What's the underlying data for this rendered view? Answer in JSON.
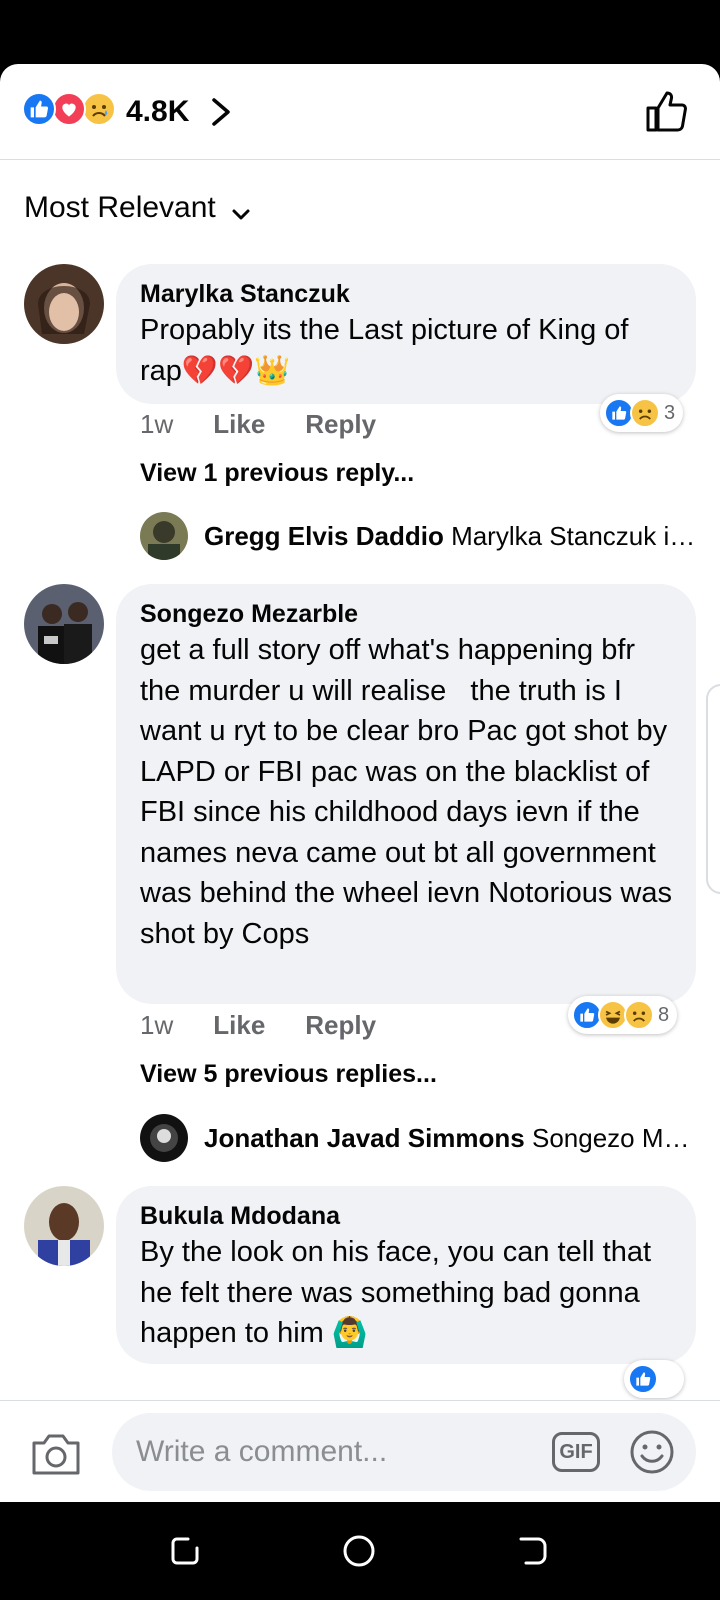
{
  "header": {
    "reaction_icons": [
      "like-icon",
      "love-icon",
      "sad-icon"
    ],
    "reaction_count": "4.8K"
  },
  "sort": {
    "label": "Most Relevant"
  },
  "comments": [
    {
      "author": "Marylka Stanczuk",
      "text": "Propably its the Last picture of King of rap💔💔👑",
      "time": "1w",
      "like_label": "Like",
      "reply_label": "Reply",
      "reactions": [
        "like",
        "sad"
      ],
      "reaction_count": "3",
      "view_previous": "View 1 previous reply...",
      "reply_preview": {
        "author": "Gregg Elvis Daddio",
        "text": "Marylka Stanczuk i…"
      }
    },
    {
      "author": "Songezo Mezarble",
      "text": "get a full story off what's happening bfr the murder u will realise   the truth is I want u ryt to be clear bro Pac got shot by LAPD or FBI pac was on the blacklist of FBI since his childhood days ievn if the names neva came out bt all government was behind the wheel ievn Notorious was shot by Cops",
      "time": "1w",
      "like_label": "Like",
      "reply_label": "Reply",
      "reactions": [
        "like",
        "haha",
        "sad"
      ],
      "reaction_count": "8",
      "view_previous": "View 5 previous replies...",
      "reply_preview": {
        "author": "Jonathan Javad Simmons",
        "text": "Songezo M…"
      }
    },
    {
      "author": "Bukula Mdodana",
      "text": "By the look on his face, you can tell that he felt there was something bad gonna happen to him 🙆‍♂️"
    }
  ],
  "composer": {
    "placeholder": "Write a comment...",
    "gif_label": "GIF"
  },
  "colors": {
    "accent": "#1877f2",
    "love": "#f33e58",
    "bubble": "#f0f2f5",
    "secondary_text": "#65676b"
  }
}
